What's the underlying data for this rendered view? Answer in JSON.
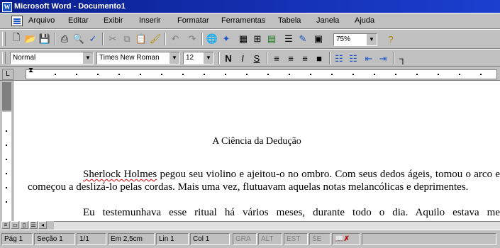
{
  "window": {
    "app_icon": "word-app-icon",
    "title": "Microsoft Word - Documento1"
  },
  "menu": {
    "items": [
      "Arquivo",
      "Editar",
      "Exibir",
      "Inserir",
      "Formatar",
      "Ferramentas",
      "Tabela",
      "Janela",
      "Ajuda"
    ]
  },
  "toolbar_standard": {
    "icons": [
      "new-icon",
      "open-icon",
      "save-icon",
      "print-icon",
      "print-preview-icon",
      "spelling-icon",
      "cut-icon",
      "copy-icon",
      "paste-icon",
      "format-painter-icon",
      "undo-icon",
      "redo-icon",
      "hyperlink-icon",
      "web-toolbar-icon",
      "tables-icon",
      "insert-table-icon",
      "excel-icon",
      "columns-icon",
      "drawing-icon",
      "document-map-icon",
      "zoom-select",
      "help-icon"
    ],
    "zoom_value": "75%"
  },
  "toolbar_formatting": {
    "style_value": "Normal",
    "font_value": "Times New Roman",
    "size_value": "12",
    "bold_label": "N",
    "italic_label": "I",
    "underline_label": "S"
  },
  "document": {
    "title": "A Ciência da Dedução",
    "paragraph1_name": "Sherlock Holmes",
    "paragraph1_rest": " pegou seu violino e ajeitou-o no ombro. Com seus dedos ágeis, tomou o arco e começou a deslizá-lo pelas cordas. Mais uma vez, flutuavam aquelas notas melancólicas e deprimentes.",
    "paragraph2": "Eu testemunhava esse ritual há vários meses, durante todo o dia. Aquilo estava me enlouquecendo. Holmes era um excelente violinista e, quando deprimido"
  },
  "status": {
    "page": "Pág 1",
    "section": "Seção 1",
    "pages": "1/1",
    "position": "Em 2,5cm",
    "line": "Lin 1",
    "column": "Col 1",
    "modes": [
      "GRA",
      "ALT",
      "EST",
      "SE"
    ],
    "spell_icon": "spelling-status-icon"
  },
  "colors": {
    "title_bar": "#0a1f8f",
    "spelling_underline": "#e00000"
  }
}
